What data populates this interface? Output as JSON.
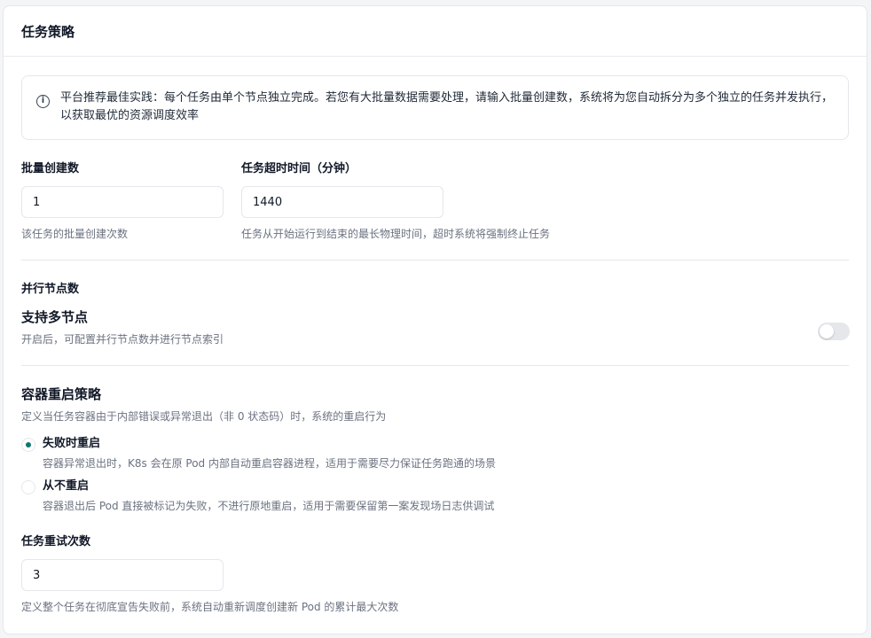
{
  "card": {
    "title": "任务策略"
  },
  "info": {
    "icon": "info-circle-icon",
    "text": "平台推荐最佳实践：每个任务由单个节点独立完成。若您有大批量数据需要处理，请输入批量创建数，系统将为您自动拆分为多个独立的任务并发执行，以获取最优的资源调度效率"
  },
  "batch": {
    "label": "批量创建数",
    "value": "1",
    "hint": "该任务的批量创建次数"
  },
  "timeout": {
    "label": "任务超时时间（分钟）",
    "value": "1440",
    "hint": "任务从开始运行到结束的最长物理时间，超时系统将强制终止任务"
  },
  "parallel": {
    "label": "并行节点数",
    "title": "支持多节点",
    "hint": "开启后，可配置并行节点数并进行节点索引",
    "enabled": false
  },
  "restart": {
    "title": "容器重启策略",
    "hint": "定义当任务容器由于内部错误或异常退出（非 0 状态码）时，系统的重启行为",
    "options": [
      {
        "label": "失败时重启",
        "desc": "容器异常退出时，K8s 会在原 Pod 内部自动重启容器进程，适用于需要尽力保证任务跑通的场景",
        "checked": true
      },
      {
        "label": "从不重启",
        "desc": "容器退出后 Pod 直接被标记为失败，不进行原地重启，适用于需要保留第一案发现场日志供调试",
        "checked": false
      }
    ]
  },
  "retry": {
    "label": "任务重试次数",
    "value": "3",
    "hint": "定义整个任务在彻底宣告失败前，系统自动重新调度创建新 Pod 的累计最大次数"
  },
  "colors": {
    "accent": "#0f766e",
    "border": "#e5e7eb",
    "muted": "#6b7280"
  }
}
